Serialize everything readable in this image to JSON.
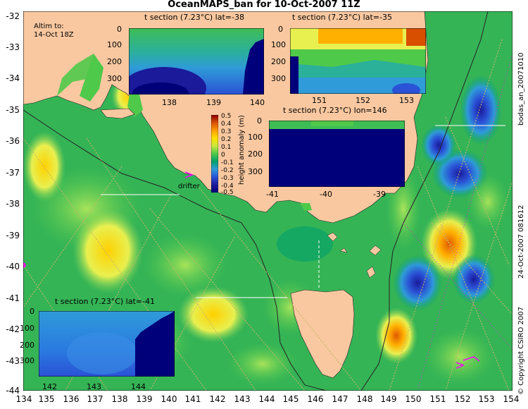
{
  "title": "OceanMAPS_ban for 10-Oct-2007 11Z",
  "altim": {
    "line1": "Altim to:",
    "line2": "14-Oct 18Z"
  },
  "drifter_label": "drifter",
  "side_labels": {
    "top": "bodas_an_20071010",
    "middle": "24-Oct-2007 081612",
    "bottom": "© Copyright CSIRO 2007"
  },
  "y_ticks": [
    "-32",
    "-33",
    "-34",
    "-35",
    "-36",
    "-37",
    "-38",
    "-39",
    "-40",
    "-41",
    "-42",
    "-43",
    "-44"
  ],
  "x_ticks": [
    "134",
    "135",
    "136",
    "137",
    "138",
    "139",
    "140",
    "141",
    "142",
    "143",
    "144",
    "145",
    "146",
    "147",
    "148",
    "149",
    "150",
    "151",
    "152",
    "153",
    "154"
  ],
  "colorbar": {
    "label": "height anomaly (m)",
    "ticks": [
      "0.5",
      "0.4",
      "0.3",
      "0.2",
      "0.1",
      "0",
      "-0.1",
      "-0.2",
      "-0.3",
      "-0.4",
      "-0.5"
    ],
    "colors": [
      "#8b0000",
      "#d94f00",
      "#ff9d00",
      "#ffe000",
      "#c8e83c",
      "#4fc94a",
      "#00a06a",
      "#2f9bd8",
      "#2a52d6",
      "#1a1a9a",
      "#000078"
    ]
  },
  "sections": [
    {
      "title": "t section (7.23°C) lat=-38",
      "y_ticks": [
        "0",
        "100",
        "200",
        "300"
      ],
      "x_ticks": [
        "138",
        "139",
        "140"
      ]
    },
    {
      "title": "t section (7.23°C) lat=-35",
      "y_ticks": [
        "0",
        "100",
        "200",
        "300"
      ],
      "x_ticks": [
        "151",
        "152",
        "153"
      ]
    },
    {
      "title": "t section (7.23°C) lon=146",
      "y_ticks": [
        "0",
        "100",
        "200",
        "300"
      ],
      "x_ticks": [
        "-41",
        "-40",
        "-39"
      ]
    },
    {
      "title": "t section (7.23°C) lat=-41",
      "y_ticks": [
        "0",
        "100",
        "200",
        "300"
      ],
      "x_ticks": [
        "142",
        "143",
        "144"
      ]
    }
  ],
  "colors": {
    "land": "#f9c8a0",
    "ocean_mid": "#22a35a",
    "ocean_light": "#7fd55a",
    "deep": "#00007a",
    "drifter": "#ff00ff"
  }
}
